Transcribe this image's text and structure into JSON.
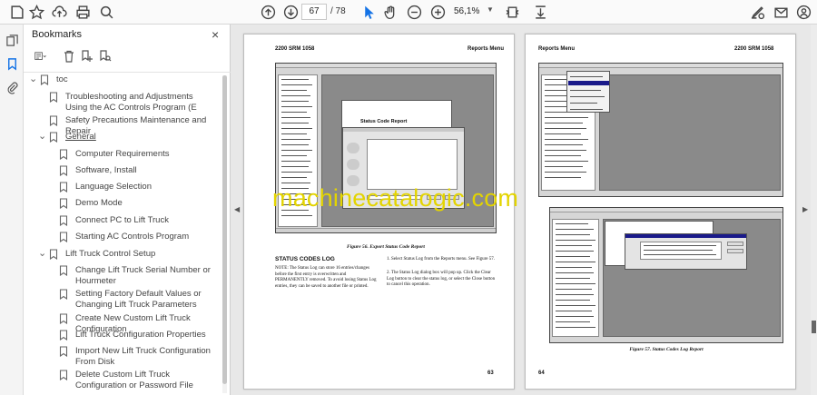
{
  "toolbar": {
    "current_page": "67",
    "page_total": "/ 78",
    "zoom": "56,1%"
  },
  "bookmarks": {
    "title": "Bookmarks",
    "close": "×",
    "items": [
      {
        "label": "toc",
        "level": 0,
        "expanded": true,
        "underline": false
      },
      {
        "label": "Troubleshooting and Adjustments Using the AC Controls Program (E",
        "level": 1,
        "expanded": null,
        "underline": false
      },
      {
        "label": "Safety Precautions Maintenance and Repair",
        "level": 1,
        "expanded": null,
        "underline": false
      },
      {
        "label": "General",
        "level": 1,
        "expanded": true,
        "underline": true
      },
      {
        "label": "Computer Requirements",
        "level": 2,
        "expanded": null,
        "underline": false
      },
      {
        "label": "Software, Install",
        "level": 2,
        "expanded": null,
        "underline": false
      },
      {
        "label": "Language Selection",
        "level": 2,
        "expanded": null,
        "underline": false
      },
      {
        "label": "Demo Mode",
        "level": 2,
        "expanded": null,
        "underline": false
      },
      {
        "label": "Connect PC to Lift Truck",
        "level": 2,
        "expanded": null,
        "underline": false
      },
      {
        "label": "Starting AC Controls Program",
        "level": 2,
        "expanded": null,
        "underline": false
      },
      {
        "label": "Lift Truck Control Setup",
        "level": 1,
        "expanded": true,
        "underline": false
      },
      {
        "label": "Change Lift Truck Serial Number or Hourmeter",
        "level": 2,
        "expanded": null,
        "underline": false
      },
      {
        "label": "Setting Factory Default Values or Changing Lift Truck Parameters",
        "level": 2,
        "expanded": null,
        "underline": false
      },
      {
        "label": "Create New Custom Lift Truck Configuration",
        "level": 2,
        "expanded": null,
        "underline": false
      },
      {
        "label": "Lift Truck Configuration Properties",
        "level": 2,
        "expanded": null,
        "underline": false
      },
      {
        "label": "Import New Lift Truck Configuration From Disk",
        "level": 2,
        "expanded": null,
        "underline": false
      },
      {
        "label": "Delete Custom Lift Truck Configuration or Password File",
        "level": 2,
        "expanded": null,
        "underline": false
      }
    ]
  },
  "document": {
    "left_page": {
      "header_left": "2200 SRM 1058",
      "header_right": "Reports Menu",
      "figure_caption": "Figure 56. Export Status Code Report",
      "dialog_title": "Status Code Report",
      "section_title": "STATUS CODES LOG",
      "note": "NOTE: The Status Log can store 16 entries/changes before the first entry is overwritten and PERMANENTLY removed. To avoid losing Status Log entries, they can be saved to another file or printed.",
      "steps": [
        "1. Select Status Log from the Reports menu. See Figure 57.",
        "2. The Status Log dialog box will pop up. Click the Clear Log button to clear the status log, or select the Close button to cancel this operation."
      ],
      "page_number": "63"
    },
    "right_page": {
      "header_left": "Reports Menu",
      "header_right": "2200 SRM 1058",
      "figure_caption": "Figure 57. Status Codes Log Report",
      "page_number": "64"
    },
    "watermark": "machinecatalogic.com"
  },
  "colors": {
    "accent": "#1473e6",
    "watermark": "#e3d400"
  }
}
